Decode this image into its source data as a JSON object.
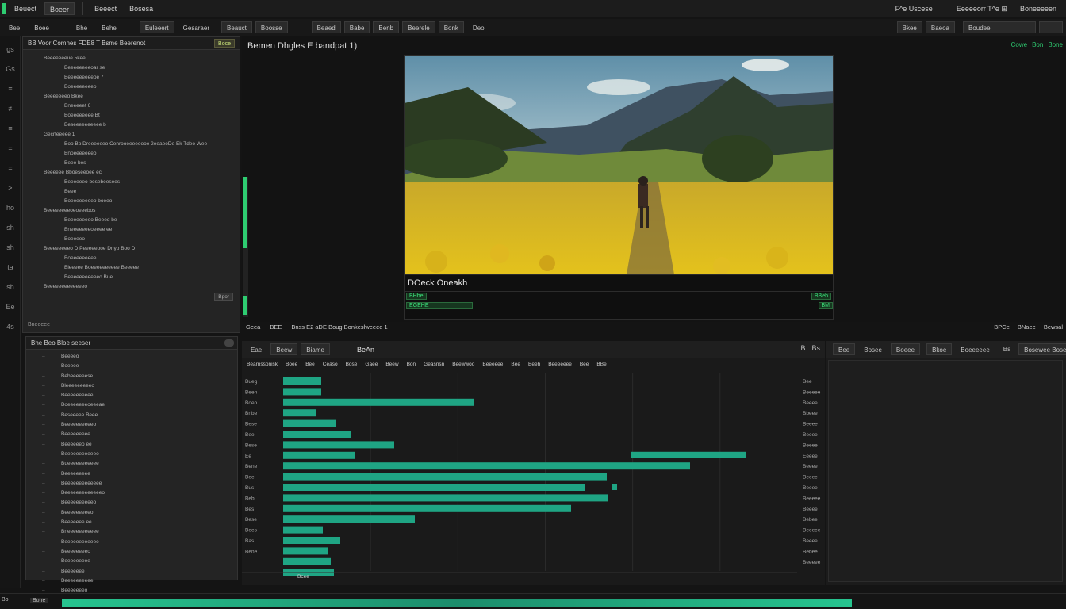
{
  "menubar": {
    "items": [
      "Beuect",
      "Boeer",
      "Beeect",
      "Bosesa"
    ],
    "right_items": [
      "F^e  Uscese",
      "Eeeeeorr  T^e  ⊞",
      "Boneeeeen"
    ]
  },
  "toolbar": {
    "left_buttons": [
      "Bee",
      "Boee",
      "Bhe",
      "Behe"
    ],
    "mid_buttons": [
      "Euleeert",
      "Gesaraer"
    ],
    "edit_buttons": [
      "Beauct",
      "Boosse"
    ],
    "view_buttons": [
      "Beaed",
      "Babe",
      "Benb",
      "Beerele",
      "Bonk"
    ],
    "view_extra": "Deo",
    "right_buttons": [
      "Bkee",
      "Baeoa",
      "Boudee"
    ]
  },
  "rail": {
    "icons": [
      "gs",
      "Gs",
      "≡",
      "≠",
      "≡",
      "=",
      "=",
      "≥",
      "ho",
      "sh",
      "sh",
      "ta",
      "sh",
      "Ee",
      "4s"
    ]
  },
  "media_browser": {
    "header": "BB Voor  Comnes FDE8 T  Bsme Beerenot",
    "header_button": "Boce",
    "items": [
      "Beeeeeeeue  5kee",
      "Beeeeeeeeoar  se",
      "Beeeeeeeeeoe  7",
      "Boeeeeeeeeo",
      "Beeeeeeeo  Bkee",
      "Bneeeeet  6",
      "Boeeeeeeee  Bt",
      "Beseeeeeeeeee  b",
      "Gecrteeeee  1",
      "Boo  Bp  Dreeeeeeo  Cenrooeeeeoooe  2eeaeeDe  Ek  Tdeo  Wee",
      "Bnoeeeeeeeo",
      "Beee  bes",
      "Beeeeee  Bboeseeoee  ec",
      "Beeeeeeo  besebeesees",
      "Beee",
      "Boeeeeeeeeo  boeeo",
      "Beeeeeeeeoeoeeebos",
      "Beeeeeeeeo  Beeed  be",
      "Bneeeeeeeoeeee  ee",
      "Boeeeeo",
      "Beeeeeeeeo  D  Peeeeeooe  Dnyo  Boo  D",
      "Boeeeeeeeee",
      "Bleeeee  Boeeeeeeeeee  Beeeee",
      "Beeeeeeeeeeeo  Bue",
      "Beeeeeeeeeeeeeo"
    ],
    "footer_label": "Bneeeee",
    "status_pill": "Bpor"
  },
  "effects_browser": {
    "header": "Bhe  Beo  Bloe  seeser",
    "items": [
      "Beeeeo",
      "Boeeee",
      "Bebeeeeeese",
      "Bleeeeeeeeeo",
      "Beeeeeeeeee",
      "Boeeeeeeeoeeeae",
      "Beseeeee  Beee",
      "Beeeeeeeeeeo",
      "Beeeeeeeee",
      "Beeeeeeo  ee",
      "Beeeeeeeeeeeo",
      "Bueeeeeeeeeee",
      "Beeeeeeeee",
      "Beeeeeeeeeeeee",
      "Beeeeeeeeeeeeeo",
      "Beeeeeeeeeeo",
      "Beeeeeeeeeo",
      "Beeeeeee  ee",
      "Bneeeeeeeeeee",
      "Beeeeeeeeeeee",
      "Beeeeeeeeo",
      "Beeeeeeeee",
      "Beeeeeee",
      "Beeeeeeeeee",
      "Beeeeeeeo"
    ]
  },
  "viewer": {
    "title": "Bemen Dhgles E bandpat 1)",
    "frame_caption": "DOeck  Oneakh",
    "transport_left": [
      "BHhe",
      "EGEHE"
    ],
    "transport_right": [
      "BBeb",
      "BM"
    ],
    "status_right": [
      "Cowe",
      "Bon",
      "Bone"
    ],
    "stats_left": [
      "Geea",
      "BEE",
      "Bnss  E2  aDE  Boug  Bonkeslweeee 1"
    ],
    "stats_right": [
      "BPCe",
      "BNaee",
      "Bewsal"
    ]
  },
  "timeline": {
    "tabs": [
      "Eae",
      "Beew",
      "Biame"
    ],
    "title": "BeAn",
    "right_icons": [
      "B",
      "Bs"
    ],
    "columns": [
      "Bearnssonisk",
      "Boee",
      "Bee",
      "Ceaso",
      "Bose",
      "Gaee",
      "Beew",
      "Bon",
      "Geasnsn",
      "Beewwoo",
      "Beeeeee",
      "Bee",
      "Beeh",
      "Beeeeeee",
      "Bee",
      "BBe"
    ],
    "row_labels": [
      "Bueg",
      "Been",
      "Boeo",
      "Bnbe",
      "Bese",
      "Bee",
      "Bese",
      "Ee",
      "Bene",
      "Bee",
      "Bus",
      "Beb",
      "Bes",
      "Bese",
      "Bees",
      "Bas",
      "Bene"
    ],
    "right_labels": [
      "Bee",
      "Beeeee",
      "Beeee",
      "Bbeee",
      "Beeee",
      "Beeee",
      "Beeee",
      "Eeeee",
      "Beeee",
      "Beeee",
      "Beeee",
      "Beeeee",
      "Beeee",
      "Bebee",
      "Beeeee",
      "Beeee",
      "Bebee",
      "Beeeee"
    ],
    "ruler_label": "Bcee",
    "clip_color": "#1fa584"
  },
  "right_panel": {
    "tabs": [
      "Bee",
      "Bosee",
      "Boeee"
    ],
    "sub_tabs": [
      "Bkoe",
      "Boeeeeee"
    ],
    "icons": [
      "Bs",
      "Bosewee Bose"
    ]
  },
  "footer": {
    "left": "Bo",
    "label": "Bone",
    "bar_color": "#27c48f"
  },
  "accent": "#2ecc71"
}
